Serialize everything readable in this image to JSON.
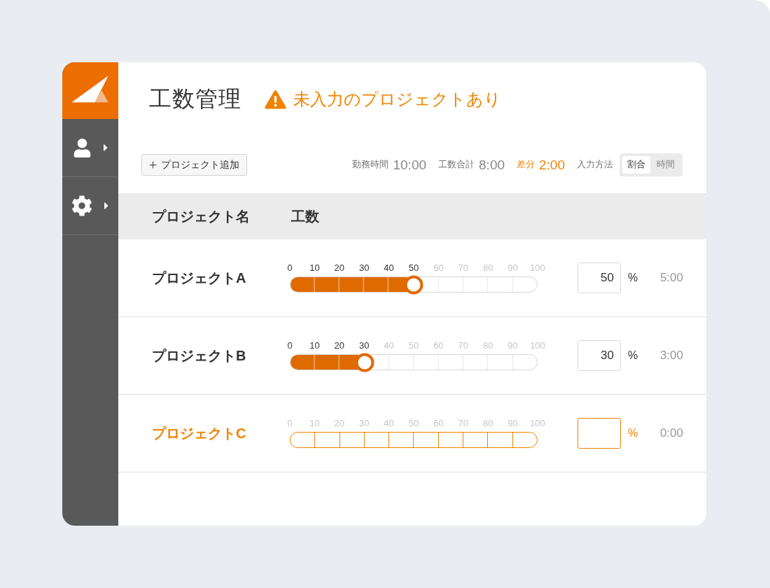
{
  "sidebar": {
    "items": [
      {
        "kind": "user"
      },
      {
        "kind": "settings"
      }
    ]
  },
  "header": {
    "title": "工数管理",
    "warning": "未入力のプロジェクトあり"
  },
  "toolbar": {
    "add_button": "プロジェクト追加",
    "stats": [
      {
        "label": "勤務時間",
        "value": "10:00",
        "highlight": false
      },
      {
        "label": "工数合計",
        "value": "8:00",
        "highlight": false
      },
      {
        "label": "差分",
        "value": "2:00",
        "highlight": true
      }
    ],
    "input_mode": {
      "label": "入力方法",
      "options": [
        {
          "label": "割合",
          "selected": true
        },
        {
          "label": "時間",
          "selected": false
        }
      ]
    }
  },
  "table": {
    "columns": [
      "プロジェクト名",
      "工数"
    ],
    "rows": [
      {
        "name": "プロジェクトA",
        "warning": false,
        "level": 0.5,
        "ticks": [
          "0",
          "10",
          "20",
          "30",
          "40",
          "50",
          "60",
          "70",
          "80",
          "90",
          "100"
        ],
        "value": "50",
        "unit": "%",
        "time": "5:00"
      },
      {
        "name": "プロジェクトB",
        "warning": false,
        "level": 0.3,
        "ticks": [
          "0",
          "10",
          "20",
          "30",
          "40",
          "50",
          "60",
          "70",
          "80",
          "90",
          "100"
        ],
        "value": "30",
        "unit": "%",
        "time": "3:00"
      },
      {
        "name": "プロジェクトC",
        "warning": true,
        "ticks": [
          "0",
          "10",
          "20",
          "30",
          "40",
          "50",
          "60",
          "70",
          "80",
          "90",
          "100"
        ],
        "unit": "%",
        "time": "0:00"
      }
    ]
  }
}
